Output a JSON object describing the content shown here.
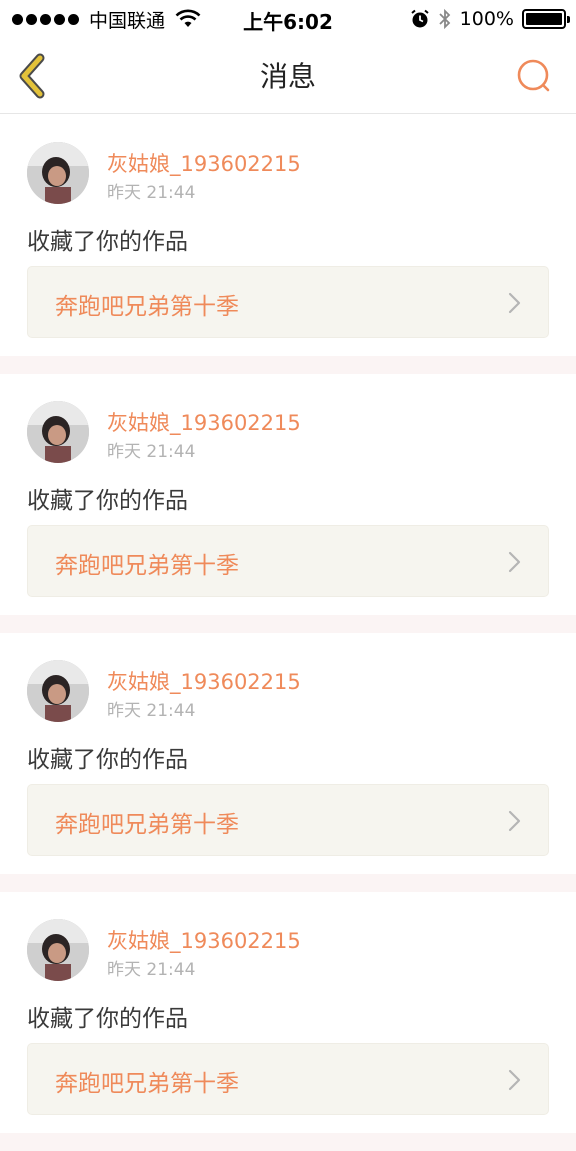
{
  "status_bar": {
    "carrier": "中国联通",
    "time": "上午6:02",
    "battery": "100%",
    "battery_level": 1.0
  },
  "nav": {
    "title": "消息",
    "back_icon": "chevron-left-icon",
    "search_icon": "search-icon",
    "accent_color": "#ef8a5a",
    "back_color": "#e3c23a"
  },
  "messages": [
    {
      "username": "灰姑娘_193602215",
      "time": "昨天 21:44",
      "action": "收藏了你的作品",
      "work_title": "奔跑吧兄弟第十季"
    },
    {
      "username": "灰姑娘_193602215",
      "time": "昨天 21:44",
      "action": "收藏了你的作品",
      "work_title": "奔跑吧兄弟第十季"
    },
    {
      "username": "灰姑娘_193602215",
      "time": "昨天 21:44",
      "action": "收藏了你的作品",
      "work_title": "奔跑吧兄弟第十季"
    },
    {
      "username": "灰姑娘_193602215",
      "time": "昨天 21:44",
      "action": "收藏了你的作品",
      "work_title": "奔跑吧兄弟第十季"
    }
  ]
}
